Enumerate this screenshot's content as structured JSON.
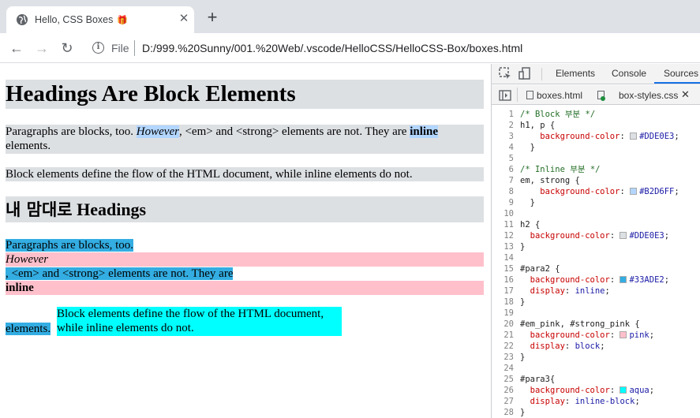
{
  "browser": {
    "tab_title": "Hello, CSS Boxes",
    "tab_emoji": "🎁",
    "close_glyph": "✕",
    "new_tab_glyph": "+",
    "back_glyph": "←",
    "forward_glyph": "→",
    "reload_glyph": "↻",
    "info_glyph": "i",
    "file_label": "File",
    "url": "D:/999.%20Sunny/001.%20Web/.vscode/HelloCSS/HelloCSS-Box/boxes.html"
  },
  "page": {
    "h1": "Headings Are Block Elements",
    "p1": {
      "before": "Paragraphs are blocks, too. ",
      "em": "However",
      "middle": ", <em> and <strong> elements are not. They are ",
      "strong": "inline",
      "after": " elements."
    },
    "p2": "Block elements define the flow of the HTML document, while inline elements do not.",
    "h2_korean": "내 맘대로",
    "h2_english": "Headings",
    "para2_line1": "Paragraphs are blocks, too.",
    "em_pink": "However",
    "para2_line2": ", <em> and <strong> elements are not. They are",
    "strong_pink": "inline",
    "para2_end": "elements.",
    "para3": "Block elements define the flow of the HTML document, while inline elements do not."
  },
  "devtools": {
    "tabs": [
      "Elements",
      "Console",
      "Sources"
    ],
    "active_tab": "Sources",
    "files": [
      "boxes.html",
      "box-styles.css"
    ],
    "close_glyph": "✕",
    "code": [
      {
        "n": "1",
        "t": "comment",
        "text": "/* Block 부분 */"
      },
      {
        "n": "2",
        "t": "plain",
        "text": "h1, p {"
      },
      {
        "n": "3",
        "t": "prop",
        "indent": "    ",
        "prop": "background-color",
        "swatch": "#DDE0E3",
        "value": "#DDE0E3"
      },
      {
        "n": "4",
        "t": "plain",
        "text": "  }"
      },
      {
        "n": "5",
        "t": "plain",
        "text": ""
      },
      {
        "n": "6",
        "t": "comment",
        "text": "/* Inline 부분 */"
      },
      {
        "n": "7",
        "t": "plain",
        "text": "em, strong {"
      },
      {
        "n": "8",
        "t": "prop",
        "indent": "    ",
        "prop": "background-color",
        "swatch": "#B2D6FF",
        "value": "#B2D6FF"
      },
      {
        "n": "9",
        "t": "plain",
        "text": "  }"
      },
      {
        "n": "10",
        "t": "plain",
        "text": ""
      },
      {
        "n": "11",
        "t": "plain",
        "text": "h2 {"
      },
      {
        "n": "12",
        "t": "prop",
        "indent": "  ",
        "prop": "background-color",
        "swatch": "#DDE0E3",
        "value": "#DDE0E3"
      },
      {
        "n": "13",
        "t": "plain",
        "text": "}"
      },
      {
        "n": "14",
        "t": "plain",
        "text": ""
      },
      {
        "n": "15",
        "t": "plain",
        "text": "#para2 {"
      },
      {
        "n": "16",
        "t": "prop",
        "indent": "  ",
        "prop": "background-color",
        "swatch": "#33ADE2",
        "value": "#33ADE2"
      },
      {
        "n": "17",
        "t": "prop",
        "indent": "  ",
        "prop": "display",
        "value": "inline"
      },
      {
        "n": "18",
        "t": "plain",
        "text": "}"
      },
      {
        "n": "19",
        "t": "plain",
        "text": ""
      },
      {
        "n": "20",
        "t": "plain",
        "text": "#em_pink, #strong_pink {"
      },
      {
        "n": "21",
        "t": "prop",
        "indent": "  ",
        "prop": "background-color",
        "swatch": "pink",
        "value": "pink"
      },
      {
        "n": "22",
        "t": "prop",
        "indent": "  ",
        "prop": "display",
        "value": "block"
      },
      {
        "n": "23",
        "t": "plain",
        "text": "}"
      },
      {
        "n": "24",
        "t": "plain",
        "text": ""
      },
      {
        "n": "25",
        "t": "plain",
        "text": "#para3{"
      },
      {
        "n": "26",
        "t": "prop",
        "indent": "  ",
        "prop": "background-color",
        "swatch": "aqua",
        "value": "aqua"
      },
      {
        "n": "27",
        "t": "prop",
        "indent": "  ",
        "prop": "display",
        "value": "inline-block"
      },
      {
        "n": "28",
        "t": "plain",
        "text": "}"
      }
    ]
  }
}
